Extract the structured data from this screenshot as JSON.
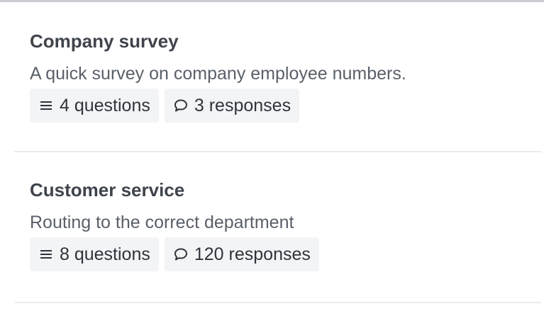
{
  "surveys": [
    {
      "title": "Company survey",
      "description": "A quick survey on company employee numbers.",
      "questions": "4 questions",
      "responses": "3 responses",
      "question_icon": "list-icon",
      "response_icon": "comment-icon"
    },
    {
      "title": "Customer service",
      "description": "Routing to the correct department",
      "questions": "8 questions",
      "responses": "120 responses",
      "question_icon": "list-icon",
      "response_icon": "comment-icon"
    }
  ],
  "colors": {
    "chip_background": "#f3f4f6",
    "divider": "#ececee",
    "title": "#3f444c",
    "description": "#5a6069"
  }
}
